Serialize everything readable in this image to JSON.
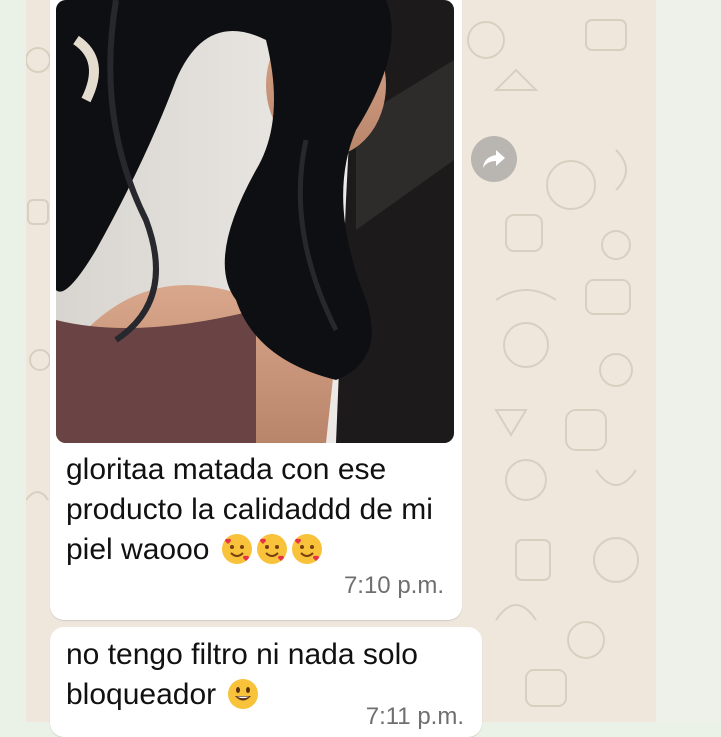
{
  "colors": {
    "chat_background": "#efe7dc",
    "bubble": "#ffffff",
    "forward_button": "#b9b6b1",
    "timestamp": "#6f6f6f"
  },
  "messages": [
    {
      "type": "image-with-caption",
      "text": "gloritaa matada con ese producto la calidaddd de mi piel waooo",
      "emojis": [
        "smiling-face-with-hearts",
        "smiling-face-with-hearts",
        "smiling-face-with-hearts"
      ],
      "time": "7:10 p.m."
    },
    {
      "type": "text",
      "text": "no tengo filtro ni nada solo bloqueador",
      "emojis": [
        "grinning-face"
      ],
      "time": "7:11 p.m."
    }
  ],
  "icons": {
    "forward": "forward-arrow-icon"
  }
}
